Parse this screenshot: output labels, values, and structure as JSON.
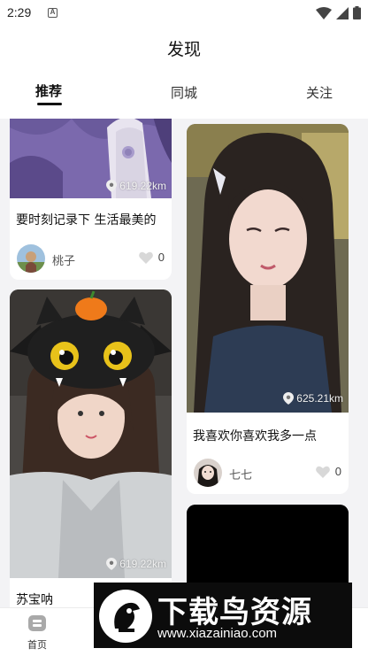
{
  "status_bar": {
    "time": "2:29",
    "notification_badge": "A"
  },
  "header": {
    "title": "发现"
  },
  "tabs": [
    {
      "label": "推荐",
      "active": true
    },
    {
      "label": "同城",
      "active": false
    },
    {
      "label": "关注",
      "active": false
    }
  ],
  "feed": {
    "left": [
      {
        "distance": "619.22km",
        "caption": "要时刻记录下 生活最美的",
        "author": "桃子",
        "likes": "0"
      },
      {
        "distance": "619.22km",
        "caption": "苏宝呐"
      }
    ],
    "right": [
      {
        "distance": "625.21km",
        "caption": "我喜欢你喜欢我多一点",
        "author": "七七",
        "likes": "0"
      }
    ]
  },
  "bottom_nav": {
    "home_label": "首页"
  },
  "watermark": {
    "title": "下载鸟资源",
    "url": "www.xiazainiao.com"
  },
  "colors": {
    "accent": "#111111",
    "background": "#f3f3f5",
    "card": "#ffffff"
  }
}
